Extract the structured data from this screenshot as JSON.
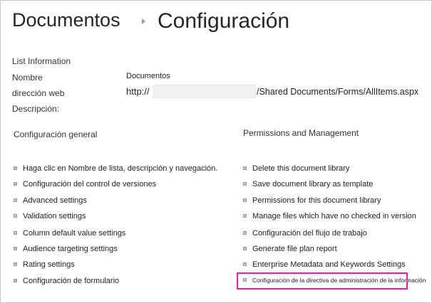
{
  "breadcrumb": {
    "site": "Documentos",
    "page": "Configuración"
  },
  "list_information": {
    "heading": "List Information",
    "name_label": "Nombre",
    "name_value": "Documentos",
    "address_label": "dirección web",
    "address_prefix": "http://",
    "address_suffix": "/Shared Documents/Forms/AllItems.aspx",
    "description_label": "Descripción:"
  },
  "general": {
    "heading": "Configuración general",
    "items": [
      "Haga clic en Nombre de lista, descripción y navegación.",
      "Configuración del control de versiones",
      "Advanced settings",
      "Validation settings",
      "Column default value settings",
      "Audience targeting settings",
      "Rating settings",
      "Configuración de formulario"
    ]
  },
  "permissions": {
    "heading": "Permissions and Management",
    "items": [
      "Delete this document library",
      "Save document library as template",
      "Permissions for this document library",
      "Manage files which have no checked in version",
      "Configuración del flujo de trabajo",
      "Generate file plan report",
      "Enterprise Metadata and Keywords Settings",
      "Configuración de la directiva de administración de la información"
    ]
  },
  "colors": {
    "highlight": "#e020a6",
    "text": "#222222"
  }
}
